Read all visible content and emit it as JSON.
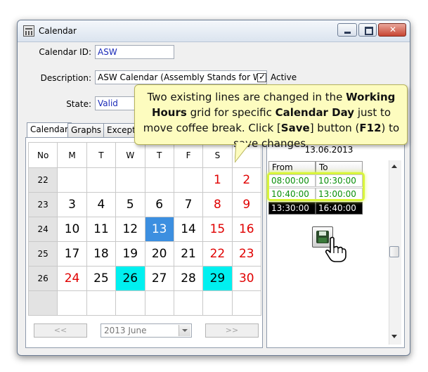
{
  "window": {
    "title": "Calendar"
  },
  "form": {
    "calendar_id_label": "Calendar ID:",
    "calendar_id_value": "ASW",
    "description_label": "Description:",
    "description_value": "ASW Calendar (Assembly Stands for Wheels)",
    "active_label": "Active",
    "active_checked": true,
    "state_label": "State:",
    "state_value": "Valid"
  },
  "tabs": [
    {
      "label": "Calendar",
      "active": true
    },
    {
      "label": "Graphs",
      "active": false
    },
    {
      "label": "Except",
      "active": false
    }
  ],
  "calendar": {
    "headers": [
      "No",
      "M",
      "T",
      "W",
      "T",
      "F",
      "S",
      ""
    ],
    "rows": [
      {
        "week": "22",
        "days": [
          "",
          "",
          "",
          "",
          "",
          "1",
          "2"
        ]
      },
      {
        "week": "23",
        "days": [
          "3",
          "4",
          "5",
          "6",
          "7",
          "8",
          "9"
        ]
      },
      {
        "week": "24",
        "days": [
          "10",
          "11",
          "12",
          "13",
          "14",
          "15",
          "16"
        ]
      },
      {
        "week": "25",
        "days": [
          "17",
          "18",
          "19",
          "20",
          "21",
          "22",
          "23"
        ]
      },
      {
        "week": "26",
        "days": [
          "24",
          "25",
          "26",
          "27",
          "28",
          "29",
          "30"
        ]
      }
    ],
    "selected_day": "13",
    "highlighted_days": [
      "26",
      "29"
    ],
    "red_days": [
      "1",
      "2",
      "8",
      "9",
      "15",
      "16",
      "22",
      "23",
      "24",
      "30"
    ],
    "nav_prev": "<<",
    "nav_next": ">>",
    "month_select": "2013 June"
  },
  "working_hours": {
    "date": "13.06.2013",
    "col_from": "From",
    "col_to": "To",
    "rows": [
      {
        "from": "08:00:00",
        "to": "10:30:00",
        "style": "green"
      },
      {
        "from": "10:40:00",
        "to": "13:00:00",
        "style": "green"
      },
      {
        "from": "13:30:00",
        "to": "16:40:00",
        "style": "black"
      }
    ]
  },
  "callout": {
    "p1": "Two existing lines are changed in the ",
    "b1": "Working Hours",
    "p2": " grid for specific ",
    "b2": "Calendar Day",
    "p3": " just to move coffee break. Click [",
    "b3": "Save",
    "p4": "] button (",
    "b4": "F12",
    "p5": ") to save changes."
  },
  "colors": {
    "selected": "#3c8fe0",
    "highlight": "#00f0f0",
    "weekend": "#e00000",
    "changed_rows": "#0a8f0a",
    "callout_bg": "#fdfcbf"
  },
  "icons": {
    "window": "calendar-app-icon",
    "save": "floppy-disk-icon",
    "cursor": "hand-pointer-icon"
  }
}
